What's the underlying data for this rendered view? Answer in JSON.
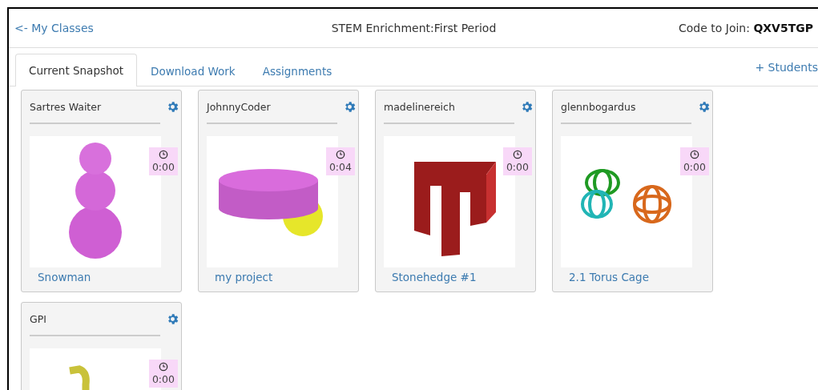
{
  "header": {
    "back_link": "<- My Classes",
    "title": "STEM Enrichment:First Period",
    "join_label": "Code to Join:",
    "join_code": "QXV5TGP"
  },
  "tabs": [
    {
      "label": "Current Snapshot",
      "selected": true
    },
    {
      "label": "Download Work",
      "selected": false
    },
    {
      "label": "Assignments",
      "selected": false
    }
  ],
  "add_students": "+ Students",
  "cards": [
    {
      "student": "Sartres Waiter",
      "time": "0:00",
      "project": "Snowman"
    },
    {
      "student": "JohnnyCoder",
      "time": "0:04",
      "project": "my project"
    },
    {
      "student": "madelinereich",
      "time": "0:00",
      "project": "Stonehedge #1"
    },
    {
      "student": "glennbogardus",
      "time": "0:00",
      "project": "2.1 Torus Cage"
    },
    {
      "student": "GPI",
      "time": "0:00"
    }
  ]
}
